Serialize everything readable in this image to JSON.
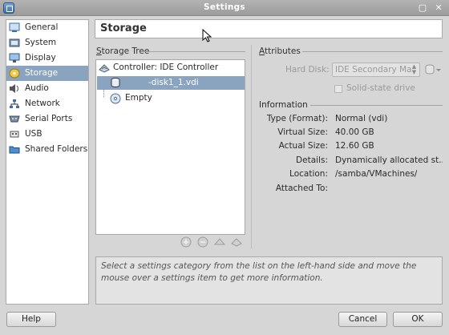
{
  "window": {
    "title": "Settings",
    "close_glyph": "✕"
  },
  "sidebar": {
    "items": [
      {
        "label": "General",
        "icon": "general-icon"
      },
      {
        "label": "System",
        "icon": "system-icon"
      },
      {
        "label": "Display",
        "icon": "display-icon"
      },
      {
        "label": "Storage",
        "icon": "storage-icon",
        "selected": true
      },
      {
        "label": "Audio",
        "icon": "audio-icon"
      },
      {
        "label": "Network",
        "icon": "network-icon"
      },
      {
        "label": "Serial Ports",
        "icon": "serial-ports-icon"
      },
      {
        "label": "USB",
        "icon": "usb-icon"
      },
      {
        "label": "Shared Folders",
        "icon": "shared-folders-icon"
      }
    ]
  },
  "page": {
    "title": "Storage"
  },
  "storage_tree": {
    "heading": "Storage Tree",
    "controller": "Controller: IDE Controller",
    "disk": "-disk1_1.vdi",
    "empty": "Empty"
  },
  "attributes": {
    "heading": "Attributes",
    "hard_disk_label": "Hard Disk:",
    "hard_disk_value": "IDE Secondary Ma",
    "ssd_label": "Solid-state drive"
  },
  "information": {
    "heading": "Information",
    "rows": [
      {
        "key": "Type (Format):",
        "value": "Normal (vdi)"
      },
      {
        "key": "Virtual Size:",
        "value": "40.00 GB"
      },
      {
        "key": "Actual Size:",
        "value": "12.60 GB"
      },
      {
        "key": "Details:",
        "value": "Dynamically allocated st..."
      },
      {
        "key": "Location:",
        "value": "/samba/VMachines/"
      },
      {
        "key": "Attached To:",
        "value": ""
      }
    ]
  },
  "info_text": "Select a settings category from the list on the left-hand side and move the mouse over a settings item to get more information.",
  "buttons": {
    "help": "Help",
    "cancel": "Cancel",
    "ok": "OK"
  },
  "colors": {
    "selection": "#8aa3bf",
    "titlebar": "#a6a6a6"
  }
}
